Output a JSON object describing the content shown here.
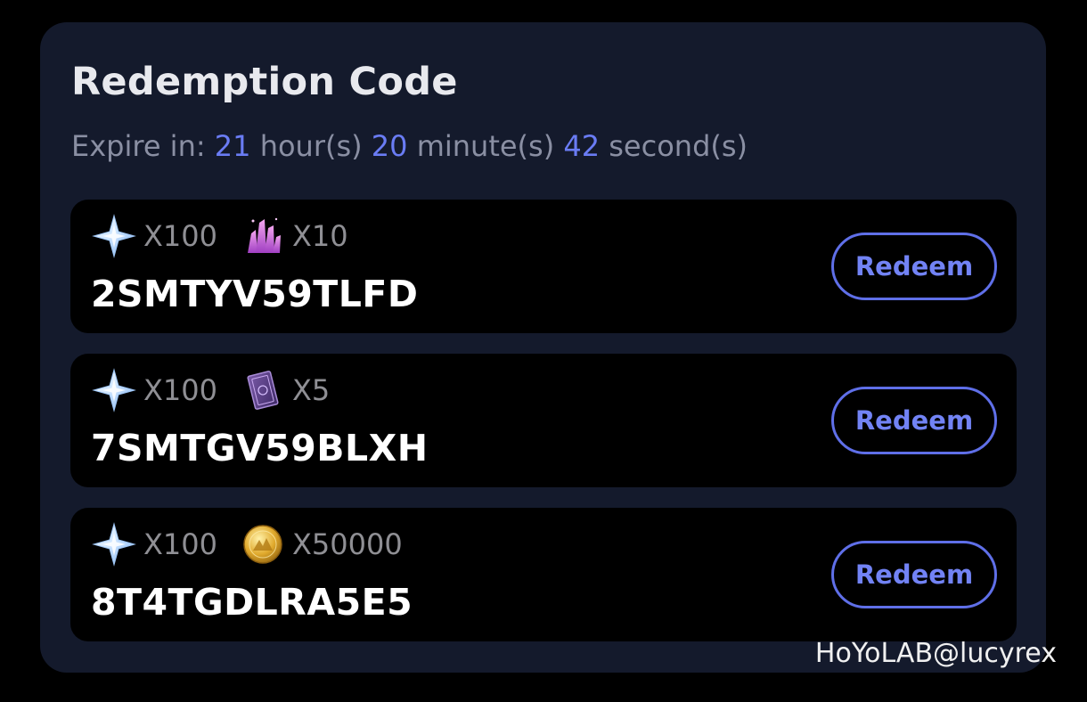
{
  "card": {
    "title": "Redemption Code",
    "expire": {
      "label": "Expire in:",
      "hours": "21",
      "hours_unit": "hour(s)",
      "minutes": "20",
      "minutes_unit": "minute(s)",
      "seconds": "42",
      "seconds_unit": "second(s)"
    },
    "codes": [
      {
        "code": "2SMTYV59TLFD",
        "rewards": [
          {
            "icon": "stellar-jade-icon",
            "qty": "X100"
          },
          {
            "icon": "crystal-icon",
            "qty": "X10"
          }
        ],
        "button_label": "Redeem"
      },
      {
        "code": "7SMTGV59BLXH",
        "rewards": [
          {
            "icon": "stellar-jade-icon",
            "qty": "X100"
          },
          {
            "icon": "book-icon",
            "qty": "X5"
          }
        ],
        "button_label": "Redeem"
      },
      {
        "code": "8T4TGDLRA5E5",
        "rewards": [
          {
            "icon": "stellar-jade-icon",
            "qty": "X100"
          },
          {
            "icon": "credit-coin-icon",
            "qty": "X50000"
          }
        ],
        "button_label": "Redeem"
      }
    ]
  },
  "watermark": "HoYoLAB@lucyrex",
  "colors": {
    "background": "#000000",
    "card": "#141a2c",
    "accent": "#6a7cf4",
    "muted_text": "#8a8fa3"
  }
}
